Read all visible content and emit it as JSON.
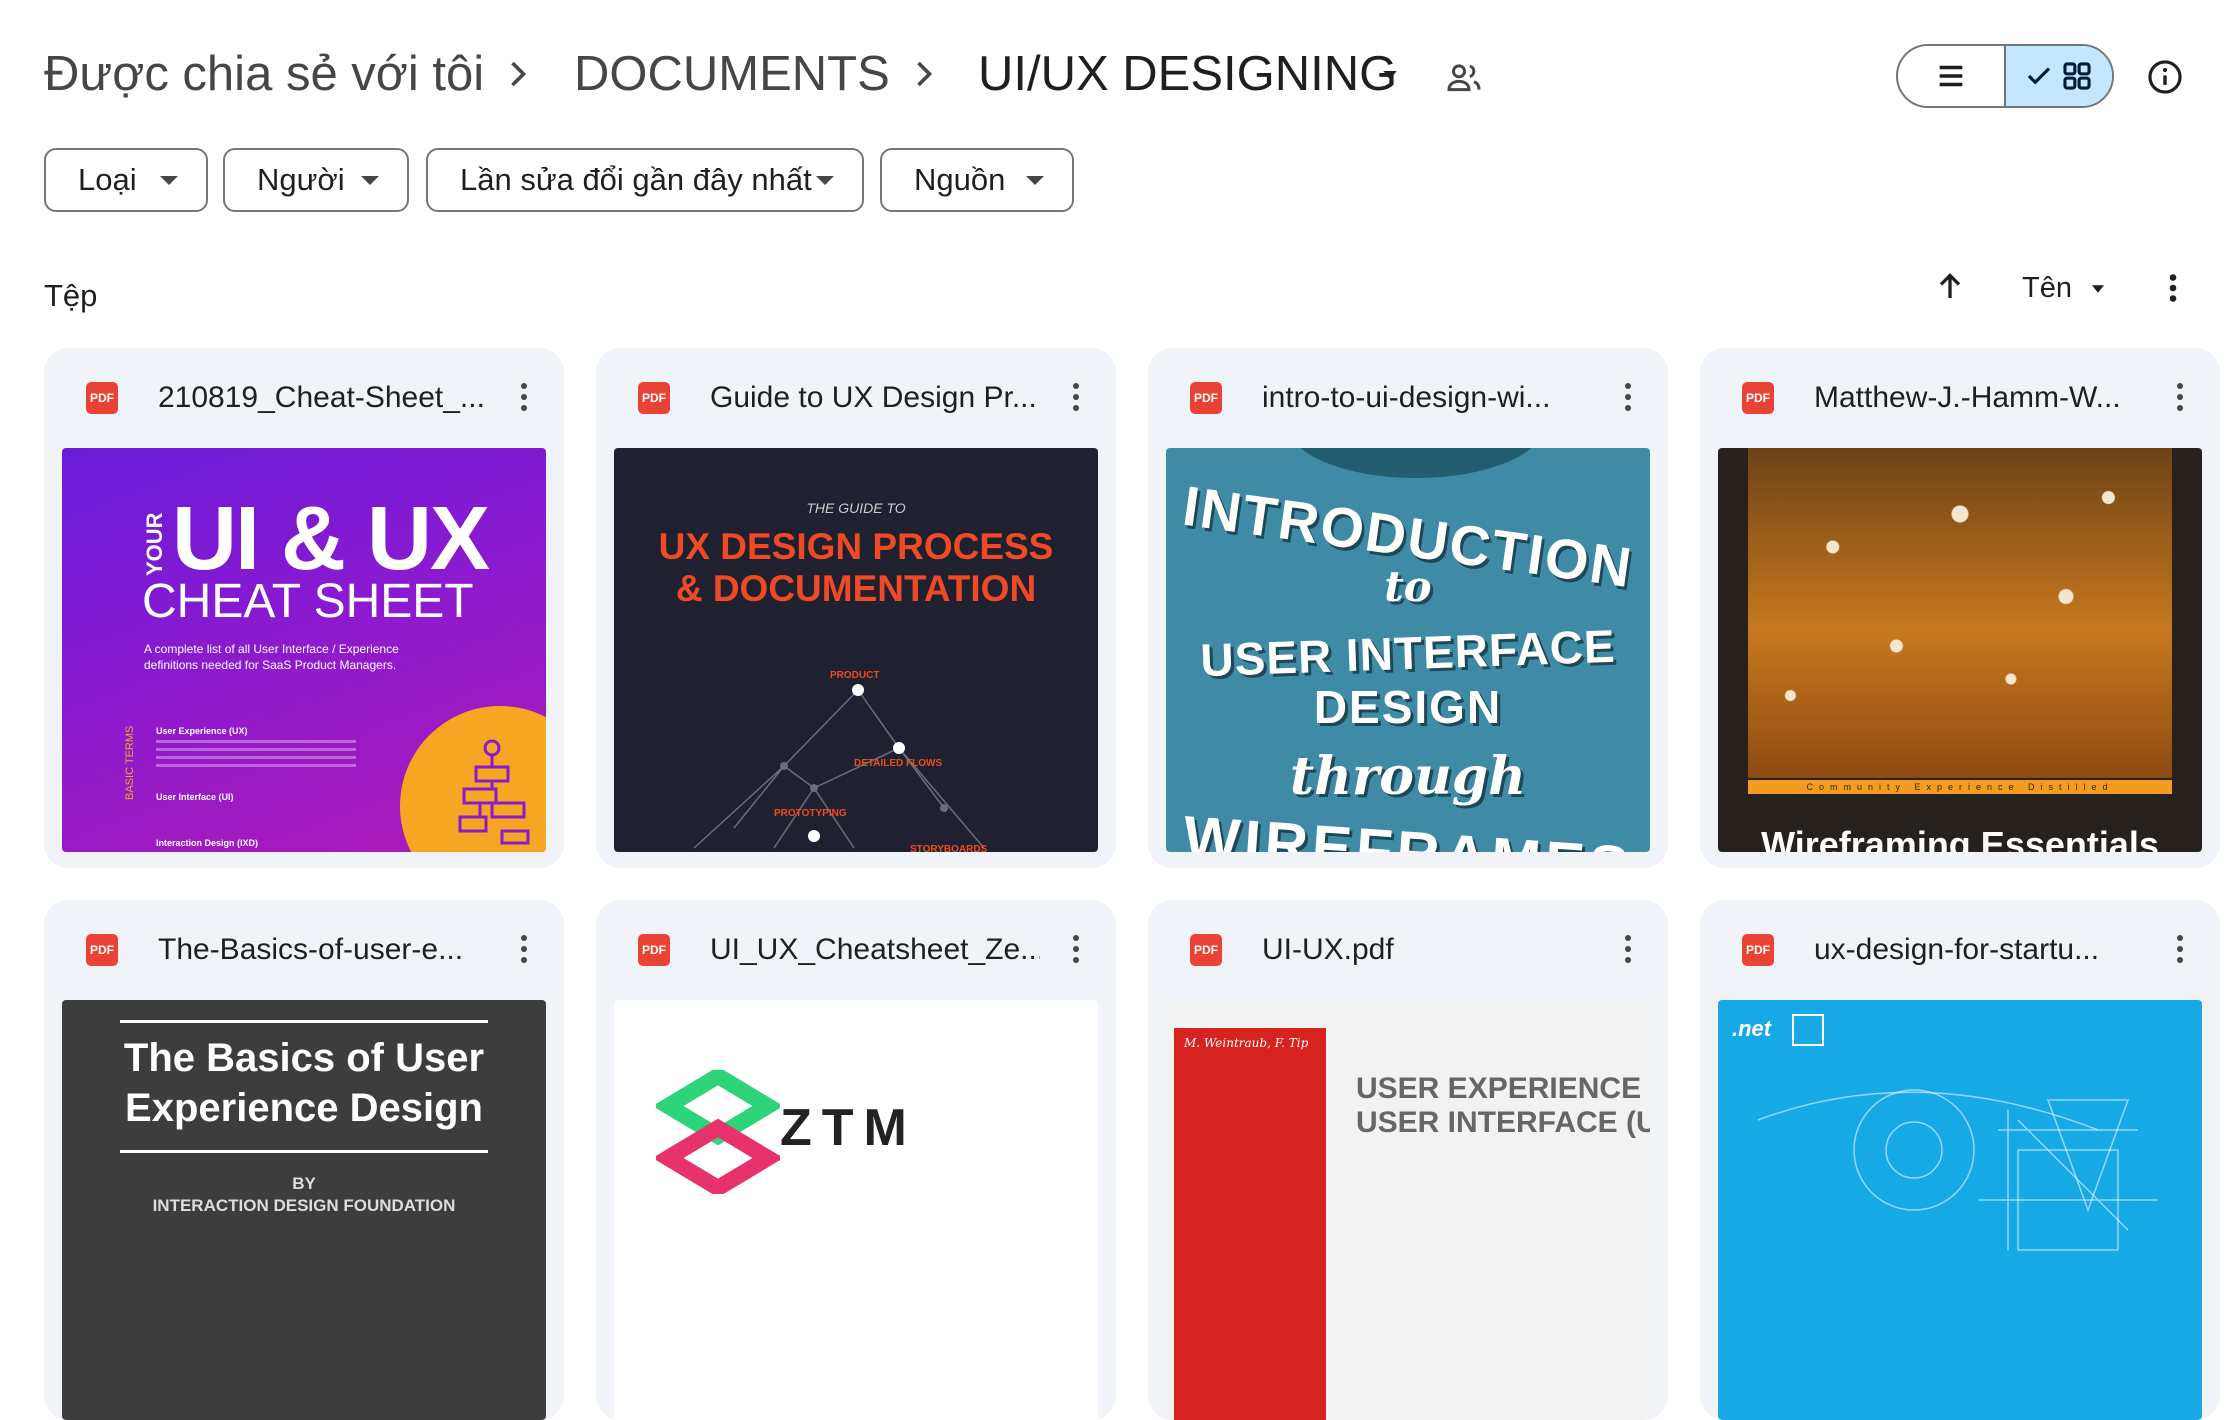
{
  "breadcrumb": {
    "root": "Được chia sẻ với tôi",
    "middle": "DOCUMENTS",
    "current": "UI/UX DESIGNING"
  },
  "filters": [
    {
      "label": "Loại"
    },
    {
      "label": "Người"
    },
    {
      "label": "Lần sửa đổi gần đây nhất"
    },
    {
      "label": "Nguồn"
    }
  ],
  "section": {
    "title": "Tệp",
    "sort_label": "Tên"
  },
  "files": [
    {
      "name": "210819_Cheat-Sheet_...",
      "type_badge": "PDF"
    },
    {
      "name": "Guide to UX Design Pr...",
      "type_badge": "PDF"
    },
    {
      "name": "intro-to-ui-design-wi...",
      "type_badge": "PDF"
    },
    {
      "name": "Matthew-J.-Hamm-W...",
      "type_badge": "PDF"
    },
    {
      "name": "The-Basics-of-user-e...",
      "type_badge": "PDF"
    },
    {
      "name": "UI_UX_Cheatsheet_Ze...",
      "type_badge": "PDF"
    },
    {
      "name": "UI-UX.pdf",
      "type_badge": "PDF"
    },
    {
      "name": "ux-design-for-startu...",
      "type_badge": "PDF"
    }
  ],
  "thumbs": {
    "t1_your": "YOUR",
    "t1_title": "UI & UX",
    "t1_sub": "CHEAT SHEET",
    "t1_desc1": "A complete list of all User Interface / Experience",
    "t1_desc2": "definitions needed for SaaS Product Managers.",
    "t1_basic": "BASIC TERMS",
    "t1_item1": "User Experience (UX)",
    "t1_item2": "User Interface (UI)",
    "t1_item3": "Interaction Design (IXD)",
    "t2_pre": "THE GUIDE TO",
    "t2_line1": "UX DESIGN PROCESS",
    "t2_line2": "& DOCUMENTATION",
    "t2_product": "PRODUCT",
    "t2_flows": "DETAILED FLOWS",
    "t2_proto": "PROTOTYPING",
    "t2_story": "STORYBOARDS",
    "t3_line1": "INTRODUCTION",
    "t3_line2": "to",
    "t3_line3": "USER INTERFACE",
    "t3_line4": "DESIGN",
    "t3_line5": "through",
    "t3_line6": "WIREFRAMES",
    "t4_band": "Community Experience Distilled",
    "t4_title": "Wireframing Essentials",
    "t5_line1": "The Basics of User",
    "t5_line2": "Experience Design",
    "t5_by": "BY",
    "t5_org": "INTERACTION DESIGN FOUNDATION",
    "t6_logo": "ZTM",
    "t7_authors": "M. Weintraub, F. Tip",
    "t7_line1": "USER EXPERIENCE (U",
    "t7_line2": "USER INTERFACE (UI)",
    "t8_logo": ".net"
  },
  "colors": {
    "selected_toggle": "#c2e7ff",
    "card_bg": "#f0f4f9",
    "pdf_red": "#ea4335",
    "accent_orange": "#f6a623"
  },
  "icons": {
    "shared": "people-icon",
    "list_view": "list-icon",
    "grid_view": "grid-icon",
    "info": "info-icon",
    "sort_direction": "arrow-up-icon",
    "more": "more-vert-icon"
  }
}
